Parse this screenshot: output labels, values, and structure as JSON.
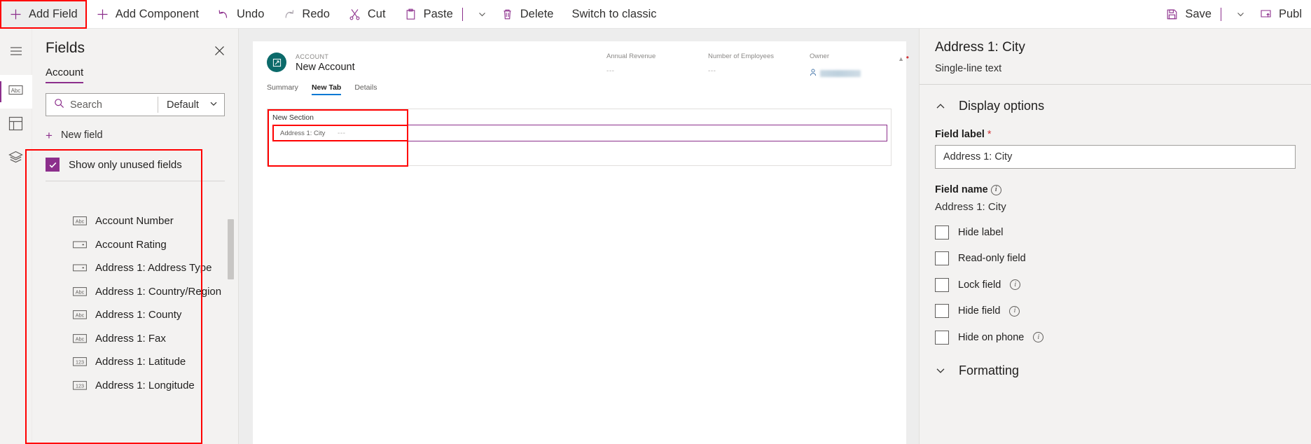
{
  "toolbar": {
    "add_field": "Add Field",
    "add_component": "Add Component",
    "undo": "Undo",
    "redo": "Redo",
    "cut": "Cut",
    "paste": "Paste",
    "delete": "Delete",
    "switch_to_classic": "Switch to classic",
    "save": "Save",
    "publish": "Publ",
    "accent_color": "#8c2f8c"
  },
  "fields_panel": {
    "title": "Fields",
    "tab": "Account",
    "search_placeholder": "Search",
    "search_value": "",
    "filter_value": "Default",
    "new_field": "New field",
    "show_only_unused": "Show only unused fields",
    "show_only_unused_checked": true,
    "items": [
      {
        "label": "Account Number",
        "icon": "abc-text-icon"
      },
      {
        "label": "Account Rating",
        "icon": "choice-dropdown-icon"
      },
      {
        "label": "Address 1: Address Type",
        "icon": "choice-dropdown-icon"
      },
      {
        "label": "Address 1: Country/Region",
        "icon": "abc-text-icon"
      },
      {
        "label": "Address 1: County",
        "icon": "abc-text-icon"
      },
      {
        "label": "Address 1: Fax",
        "icon": "abc-text-icon"
      },
      {
        "label": "Address 1: Latitude",
        "icon": "number-123-icon"
      },
      {
        "label": "Address 1: Longitude",
        "icon": "number-123-icon"
      }
    ]
  },
  "canvas": {
    "record_eyebrow": "ACCOUNT",
    "record_name": "New Account",
    "header_columns": [
      {
        "label": "Annual Revenue",
        "value": "---",
        "required": false
      },
      {
        "label": "Number of Employees",
        "value": "---",
        "required": false
      },
      {
        "label": "Owner",
        "value": "",
        "required": true
      }
    ],
    "tabs": [
      {
        "label": "Summary",
        "selected": false
      },
      {
        "label": "New Tab",
        "selected": true
      },
      {
        "label": "Details",
        "selected": false
      }
    ],
    "section_label": "New Section",
    "field_label": "Address 1: City",
    "field_value": "---"
  },
  "properties": {
    "title": "Address 1: City",
    "subtitle": "Single-line text",
    "display_options_heading": "Display options",
    "field_label_heading": "Field label",
    "field_label_required": "*",
    "field_label_value": "Address 1: City",
    "field_name_heading": "Field name",
    "field_name_value": "Address 1: City",
    "checkboxes": [
      {
        "label": "Hide label",
        "checked": false,
        "info": false
      },
      {
        "label": "Read-only field",
        "checked": false,
        "info": false
      },
      {
        "label": "Lock field",
        "checked": false,
        "info": true
      },
      {
        "label": "Hide field",
        "checked": false,
        "info": true
      },
      {
        "label": "Hide on phone",
        "checked": false,
        "info": true
      }
    ],
    "formatting_heading": "Formatting"
  }
}
